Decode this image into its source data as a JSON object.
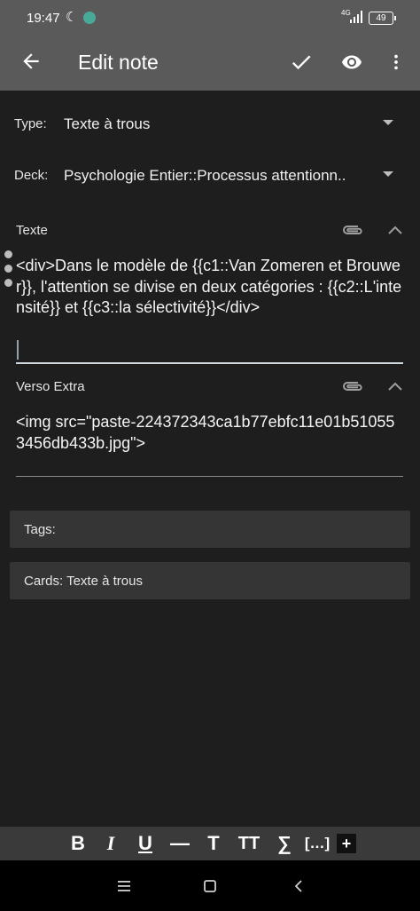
{
  "status_bar": {
    "time": "19:47",
    "network": "4G",
    "battery": "49"
  },
  "app_bar": {
    "title": "Edit note",
    "icons": [
      "back-arrow-icon",
      "check-icon",
      "eye-icon",
      "more-vert-icon"
    ]
  },
  "note_type": {
    "label": "Type:",
    "value": "Texte à trous"
  },
  "deck": {
    "label": "Deck:",
    "value": "Psychologie Entier::Processus attentionn.."
  },
  "fields": [
    {
      "label": "Texte",
      "content": "<div>Dans le modèle de {{c1::Van Zomeren et Brouwer}}, l'attention se divise en deux catégories : {{c2::L'intensité}} et {{c3::la sélectivité}}</div>"
    },
    {
      "label": "Verso Extra",
      "content": "<img src=\"paste-224372343ca1b77ebfc11e01b510553456db433b.jpg\">"
    }
  ],
  "tags": {
    "label": "Tags:"
  },
  "cards": {
    "label": "Cards: Texte à trous"
  },
  "format_toolbar": {
    "bold": "B",
    "italic": "I",
    "underline": "U",
    "horizontal_rule": "—",
    "font_size": "T",
    "title_case": "TT",
    "mathjax": "∑",
    "cloze": "[…]",
    "add": "+"
  },
  "colors": {
    "app_bar": "#5a5a5a",
    "background": "#1e1e1e",
    "card": "#353535",
    "toolbar": "#3a3a3a"
  }
}
